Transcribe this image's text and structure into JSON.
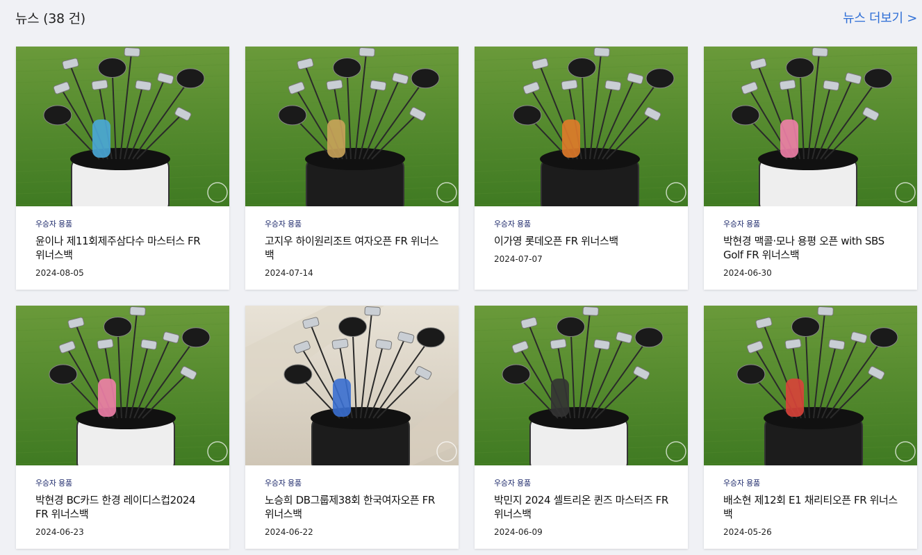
{
  "section": {
    "title": "뉴스 (38 건)",
    "more_label": "뉴스 더보기 >"
  },
  "cards": [
    {
      "category": "우승자 용품",
      "title": "윤이나 제11회제주삼다수 마스터스 FR 위너스백",
      "date": "2024-08-05",
      "bg": "grass",
      "bag": "white",
      "accent": "#4aa8d8"
    },
    {
      "category": "우승자 용품",
      "title": "고지우 하이원리조트 여자오픈 FR 위너스백",
      "date": "2024-07-14",
      "bg": "grass",
      "bag": "black",
      "accent": "#c9a35a"
    },
    {
      "category": "우승자 용품",
      "title": "이가영 롯데오픈 FR 위너스백",
      "date": "2024-07-07",
      "bg": "grass",
      "bag": "black",
      "accent": "#e07b2a"
    },
    {
      "category": "우승자 용품",
      "title": "박현경 맥콜·모나 용평 오픈 with SBS Golf FR 위너스백",
      "date": "2024-06-30",
      "bg": "grass",
      "bag": "white",
      "accent": "#f07fa8"
    },
    {
      "category": "우승자 용품",
      "title": "박현경 BC카드 한경 레이디스컵2024 FR 위너스백",
      "date": "2024-06-23",
      "bg": "grass",
      "bag": "white",
      "accent": "#f07fa8"
    },
    {
      "category": "우승자 용품",
      "title": "노승희 DB그룹제38회 한국여자오픈 FR 위너스백",
      "date": "2024-06-22",
      "bg": "marble",
      "bag": "black",
      "accent": "#3a6fd0"
    },
    {
      "category": "우승자 용품",
      "title": "박민지 2024 셀트리온 퀸즈 마스터즈 FR 위너스백",
      "date": "2024-06-09",
      "bg": "grass",
      "bag": "white",
      "accent": "#333333"
    },
    {
      "category": "우승자 용품",
      "title": "배소현 제12회 E1 채리티오픈 FR 위너스백",
      "date": "2024-05-26",
      "bg": "grass",
      "bag": "black",
      "accent": "#d9423a"
    }
  ]
}
